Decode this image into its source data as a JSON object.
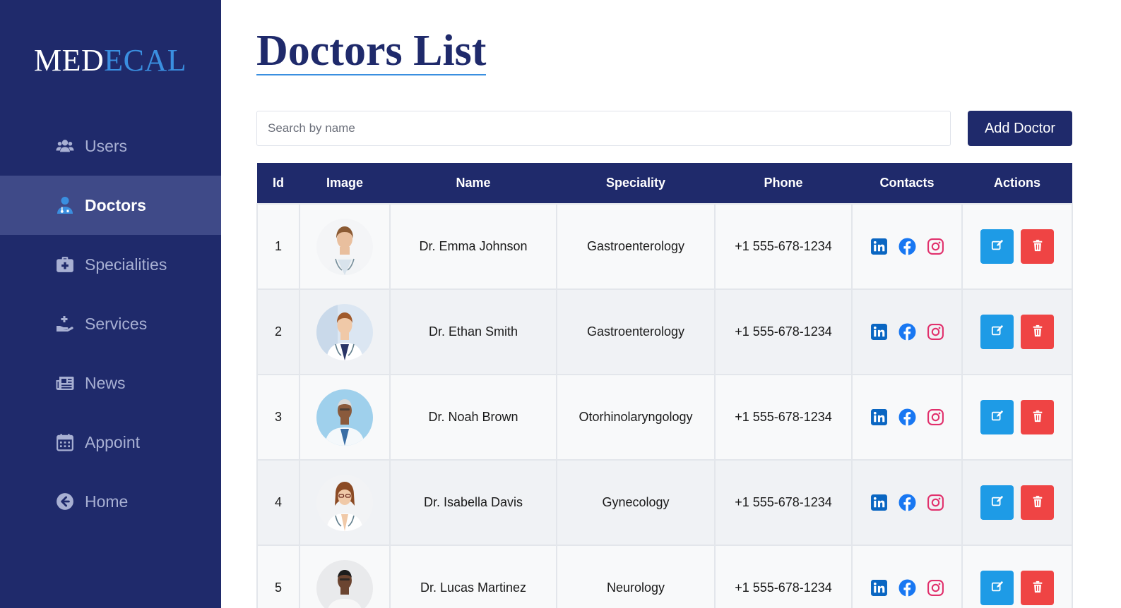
{
  "logo": {
    "part1": "MED",
    "part2": "ECAL"
  },
  "sidebar": {
    "items": [
      {
        "label": "Users",
        "icon": "users-icon",
        "active": false
      },
      {
        "label": "Doctors",
        "icon": "doctor-icon",
        "active": true
      },
      {
        "label": "Specialities",
        "icon": "medkit-icon",
        "active": false
      },
      {
        "label": "Services",
        "icon": "hand-plus-icon",
        "active": false
      },
      {
        "label": "News",
        "icon": "newspaper-icon",
        "active": false
      },
      {
        "label": "Appoint",
        "icon": "calendar-icon",
        "active": false
      },
      {
        "label": "Home",
        "icon": "back-arrow-icon",
        "active": false
      }
    ]
  },
  "page": {
    "title": "Doctors List"
  },
  "search": {
    "placeholder": "Search by name",
    "value": ""
  },
  "add_button": {
    "label": "Add Doctor"
  },
  "table": {
    "columns": [
      "Id",
      "Image",
      "Name",
      "Speciality",
      "Phone",
      "Contacts",
      "Actions"
    ],
    "rows": [
      {
        "id": "1",
        "name": "Dr. Emma Johnson",
        "speciality": "Gastroenterology",
        "phone": "+1 555-678-1234"
      },
      {
        "id": "2",
        "name": "Dr. Ethan Smith",
        "speciality": "Gastroenterology",
        "phone": "+1 555-678-1234"
      },
      {
        "id": "3",
        "name": "Dr. Noah Brown",
        "speciality": "Otorhinolaryngology",
        "phone": "+1 555-678-1234"
      },
      {
        "id": "4",
        "name": "Dr. Isabella Davis",
        "speciality": "Gynecology",
        "phone": "+1 555-678-1234"
      },
      {
        "id": "5",
        "name": "Dr. Lucas Martinez",
        "speciality": "Neurology",
        "phone": "+1 555-678-1234"
      }
    ]
  },
  "colors": {
    "sidebar_bg": "#1f2a6b",
    "active_item_bg": "#3f4a88",
    "accent": "#3a8fe0",
    "edit": "#1e9be6",
    "delete": "#ef4444",
    "linkedin": "#0a66c2",
    "facebook": "#1877f2",
    "instagram": "#e1306c"
  }
}
